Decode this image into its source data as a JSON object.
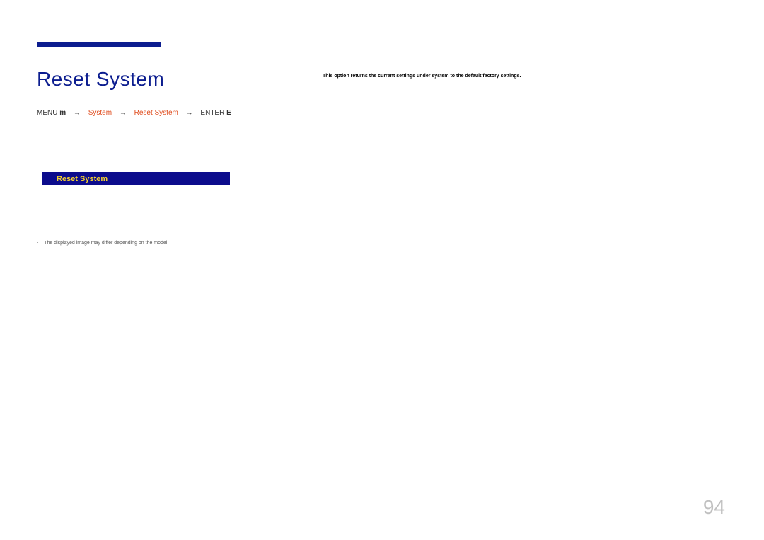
{
  "page": {
    "title": "Reset System",
    "number": "94"
  },
  "breadcrumb": {
    "menu_label": "MENU",
    "menu_icon": "m",
    "system_label": "System",
    "reset_label": "Reset System",
    "enter_label": "ENTER",
    "enter_icon": "E"
  },
  "menu": {
    "selected_item": "Reset System"
  },
  "footnote": {
    "dash": "-",
    "text": "The displayed image may differ depending on the model."
  },
  "description": {
    "text": "This option returns the current settings under system to the default factory settings."
  }
}
